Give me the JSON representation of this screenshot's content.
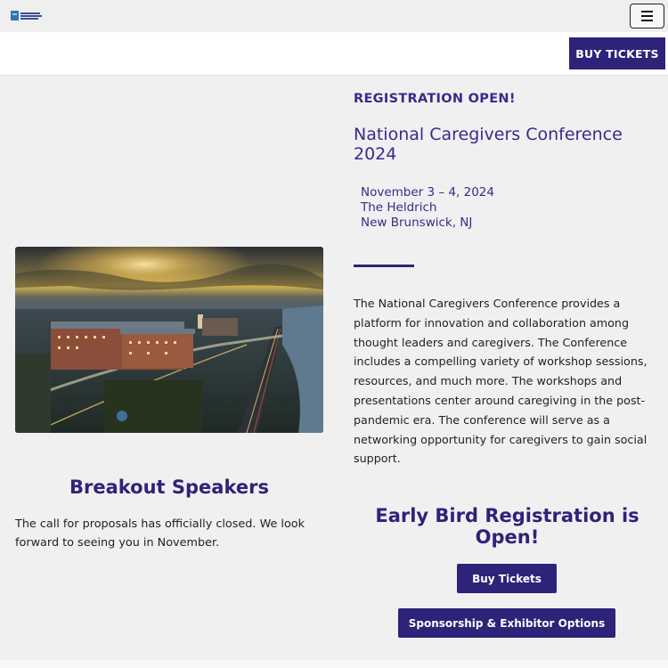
{
  "header": {
    "logo_icon": "conference-logo-icon",
    "menu_icon": "hamburger-menu-icon",
    "buy_tickets_label": "BUY TICKETS"
  },
  "hero": {
    "image_icon": "aerial-city-photo",
    "registration_label": "REGISTRATION OPEN!",
    "title": "National Caregivers Conference 2024",
    "date": "November 3 – 4, 2024",
    "venue": "The Heldrich",
    "location": "New Brunswick, NJ",
    "description": "The National Caregivers Conference provides a platform for innovation and collaboration among thought leaders and caregivers. The Conference includes a compelling variety of workshop sessions, resources, and much more. The workshops and presentations center around caregiving in the post-pandemic era. The conference will serve as a networking opportunity for caregivers to gain social support."
  },
  "breakout": {
    "title": "Breakout Speakers",
    "text": "The call for proposals has officially closed. We look forward to seeing you in November."
  },
  "early_bird": {
    "title": "Early Bird Registration is Open!",
    "buy_tickets_label": "Buy Tickets",
    "sponsorship_label": "Sponsorship & Exhibitor Options"
  },
  "colors": {
    "brand_purple": "#2d2379",
    "heading_purple": "#3a2a8a",
    "page_bg": "#f0f0f1"
  }
}
